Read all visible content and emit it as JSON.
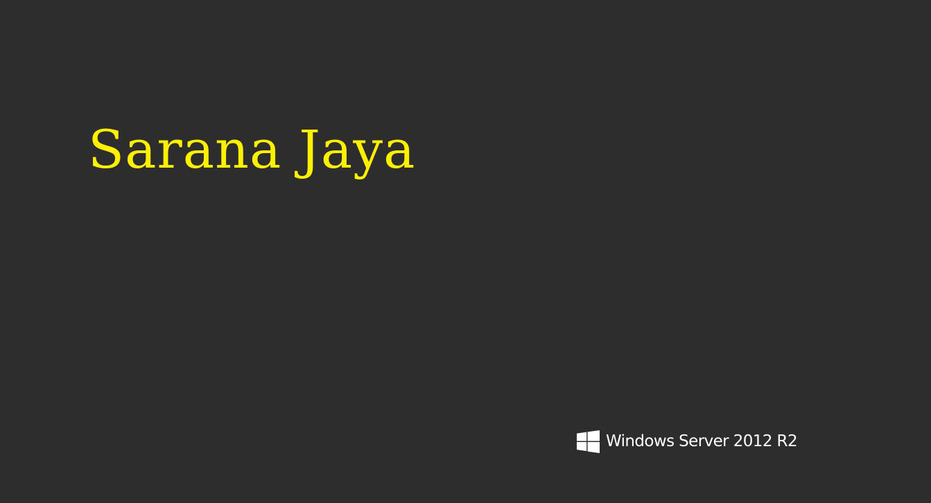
{
  "desktop": {
    "background_color": "#2d2d2d",
    "headline": {
      "text": "Sarana Jaya",
      "color": "#ffef00"
    },
    "branding": {
      "logo_icon": "windows-logo-icon",
      "text": "Windows Server 2012 R2",
      "color": "#ffffff"
    }
  }
}
